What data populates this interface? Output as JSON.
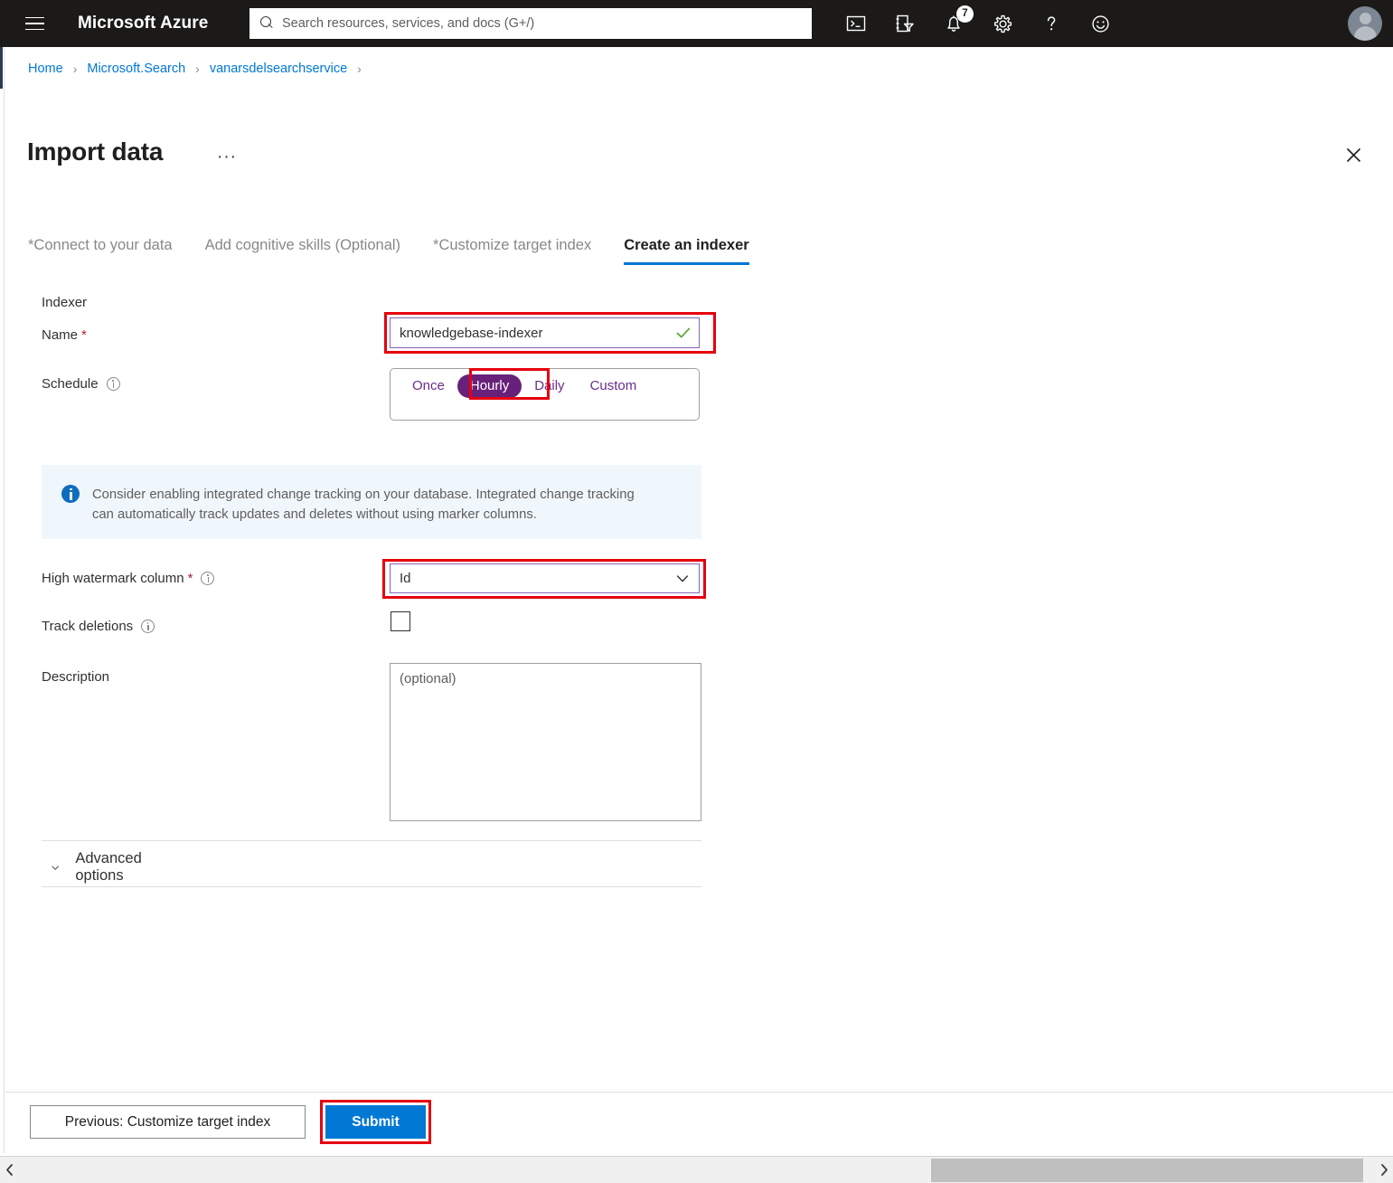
{
  "topbar": {
    "menu_icon": "hamburger-icon",
    "brand": "Microsoft Azure",
    "search": {
      "placeholder": "Search resources, services, and docs (G+/)",
      "value": "",
      "icon": "search-icon"
    },
    "icons": [
      {
        "name": "cloud-shell-icon",
        "label": "Cloud Shell"
      },
      {
        "name": "directory-filter-icon",
        "label": "Directories + subscriptions"
      },
      {
        "name": "notifications-bell-icon",
        "label": "Notifications",
        "badge": "7"
      },
      {
        "name": "settings-gear-icon",
        "label": "Settings"
      },
      {
        "name": "help-question-icon",
        "label": "Help"
      },
      {
        "name": "feedback-smiley-icon",
        "label": "Feedback"
      }
    ],
    "avatar": "user-avatar"
  },
  "breadcrumb": {
    "items": [
      {
        "label": "Home"
      },
      {
        "label": "Microsoft.Search"
      },
      {
        "label": "vanarsdelsearchservice"
      }
    ],
    "separator": "›"
  },
  "blade": {
    "title": "Import data",
    "context_menu": "···",
    "close_icon": "close-icon"
  },
  "tabs": [
    {
      "label": "Connect to your data",
      "required_marker": "*",
      "active": false
    },
    {
      "label": "Add cognitive skills (Optional)",
      "required_marker": "",
      "active": false
    },
    {
      "label": "Customize target index",
      "required_marker": "*",
      "active": false
    },
    {
      "label": "Create an indexer",
      "required_marker": "",
      "active": true
    }
  ],
  "form": {
    "section_label": "Indexer",
    "name": {
      "label": "Name",
      "required": "*",
      "value": "knowledgebase-indexer",
      "placeholder": "",
      "validation_icon": "green-checkmark-icon"
    },
    "schedule": {
      "label": "Schedule",
      "info_icon": "info-icon",
      "options": [
        "Once",
        "Hourly",
        "Daily",
        "Custom"
      ],
      "selected": "Hourly"
    },
    "info_banner": {
      "icon": "info-filled-icon",
      "text": "Consider enabling integrated change tracking on your database. Integrated change tracking can automatically track updates and deletes without using marker columns."
    },
    "high_watermark": {
      "label": "High watermark column",
      "required": "*",
      "info_icon": "info-icon",
      "value": "Id",
      "chevron_icon": "chevron-down-icon"
    },
    "track_deletions": {
      "label": "Track deletions",
      "info_icon": "info-icon",
      "checked": false
    },
    "description": {
      "label": "Description",
      "placeholder": "(optional)",
      "value": ""
    },
    "advanced_options": {
      "label": "Advanced options",
      "chevron_icon": "chevron-down-icon",
      "expanded": false
    }
  },
  "footer": {
    "previous_label": "Previous: Customize target index",
    "submit_label": "Submit"
  },
  "scrollbar": {
    "left_arrow_icon": "chevron-left-icon",
    "right_arrow_icon": "chevron-right-icon"
  },
  "colors": {
    "azure_blue": "#0078d4",
    "purple_accent": "#68217a",
    "purple_border": "#8764b8",
    "annotation_red": "#e6000f",
    "banner_bg": "#eff6fc",
    "topbar_bg": "#1b1a19",
    "required_star": "#a4262c"
  }
}
